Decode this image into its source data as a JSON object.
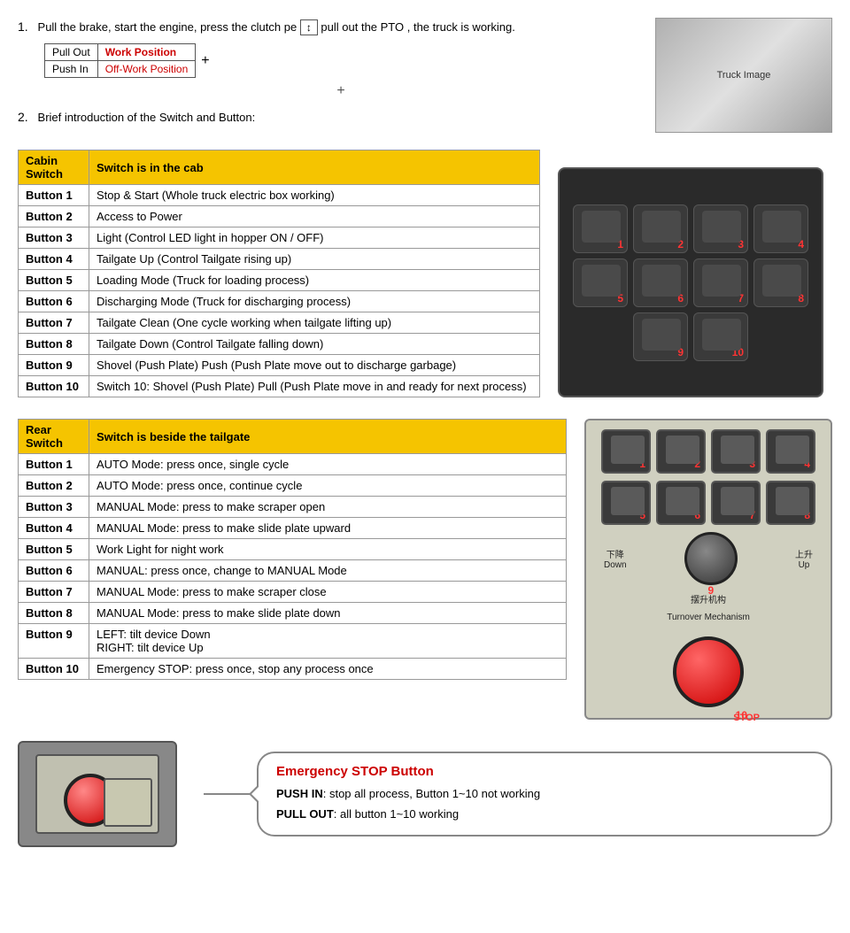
{
  "intro": {
    "step1": "Pull the brake, start the engine, press the clutch pe    pull out the PTO , the truck is working.",
    "step2": "Brief introduction of the Switch and Button:",
    "pto_table": {
      "row1_label": "Pull Out",
      "row1_value": "Work Position",
      "row2_label": "Push In",
      "row2_value": "Off-Work Position"
    }
  },
  "cabin_switch": {
    "header_col1": "Cabin Switch",
    "header_col2": "Switch is in the cab",
    "callout": "Cabin  Switch",
    "rows": [
      {
        "button": "Button 1",
        "desc": "Stop & Start (Whole truck electric box working)"
      },
      {
        "button": "Button 2",
        "desc": "Access to Power"
      },
      {
        "button": "Button 3",
        "desc": "Light (Control LED light in hopper ON / OFF)"
      },
      {
        "button": "Button 4",
        "desc": "Tailgate Up (Control Tailgate rising up)"
      },
      {
        "button": "Button 5",
        "desc": "Loading Mode (Truck for loading process)"
      },
      {
        "button": "Button 6",
        "desc": "Discharging Mode (Truck for discharging process)"
      },
      {
        "button": "Button 7",
        "desc": "Tailgate Clean (One cycle working when tailgate lifting up)"
      },
      {
        "button": "Button 8",
        "desc": "Tailgate Down (Control Tailgate falling down)"
      },
      {
        "button": "Button 9",
        "desc": "Shovel (Push Plate) Push (Push Plate move out to discharge garbage)"
      },
      {
        "button": "Button 10",
        "desc": "Switch 10: Shovel (Push Plate) Pull (Push Plate move in and ready for next process)"
      }
    ]
  },
  "rear_switch": {
    "header_col1": "Rear Switch",
    "header_col2": "Switch is beside the tailgate",
    "rows": [
      {
        "button": "Button 1",
        "desc": "AUTO Mode: press once, single cycle"
      },
      {
        "button": "Button 2",
        "desc": "AUTO Mode: press once, continue cycle"
      },
      {
        "button": "Button 3",
        "desc": "MANUAL Mode: press to make scraper open"
      },
      {
        "button": "Button 4",
        "desc": "MANUAL Mode: press to make slide plate upward"
      },
      {
        "button": "Button 5",
        "desc": "Work Light for night work"
      },
      {
        "button": "Button 6",
        "desc": "MANUAL: press once, change to MANUAL Mode"
      },
      {
        "button": "Button 7",
        "desc": "MANUAL Mode: press to make scraper close"
      },
      {
        "button": "Button 8",
        "desc": "MANUAL Mode: press to make slide plate down"
      },
      {
        "button": "Button 9",
        "desc": "LEFT: tilt device Down\nRIGHT: tilt device Up"
      },
      {
        "button": "Button 10",
        "desc": "Emergency STOP: press once, stop any process once"
      }
    ],
    "knob_down": "下降\nDown",
    "knob_up": "上升\nUp",
    "turnover_cn": "摆升机构",
    "turnover_en": "Turnover Mechanism",
    "stop_label": "STOP"
  },
  "emergency_stop": {
    "title": "Emergency  STOP Button",
    "line1_label": "PUSH IN",
    "line1_text": ": stop all process, Button 1~10 not working",
    "line2_label": "PULL OUT",
    "line2_text": ": all button 1~10 working"
  },
  "panel_buttons_cabin": [
    "1",
    "2",
    "3",
    "4",
    "5",
    "6",
    "7",
    "8",
    "9",
    "10"
  ],
  "panel_buttons_rear": [
    "1",
    "2",
    "3",
    "4",
    "5",
    "6",
    "7",
    "8"
  ]
}
